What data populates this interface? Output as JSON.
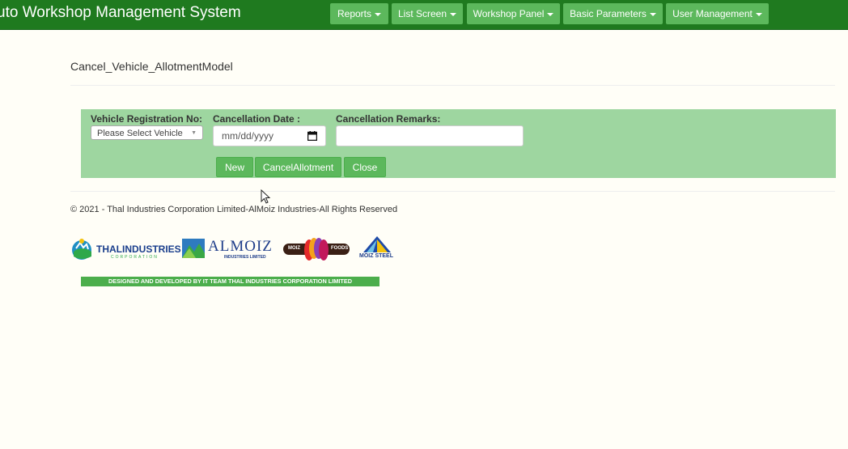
{
  "app": {
    "title": "uto Workshop Management System"
  },
  "nav": {
    "items": [
      {
        "label": "Reports"
      },
      {
        "label": "List Screen"
      },
      {
        "label": "Workshop Panel"
      },
      {
        "label": "Basic Parameters"
      },
      {
        "label": "User Management"
      }
    ]
  },
  "page": {
    "title": "Cancel_Vehicle_AllotmentModel"
  },
  "form": {
    "vehicle_label": "Vehicle Registration No:",
    "vehicle_selected": "Please Select Vehicle",
    "date_label": "Cancellation Date :",
    "date_placeholder": "mm/dd/yyyy",
    "remarks_label": "Cancellation Remarks:",
    "remarks_value": "",
    "buttons": {
      "new": "New",
      "cancel_allotment": "CancelAllotment",
      "close": "Close"
    }
  },
  "footer": {
    "copyright": "© 2021 - Thal Industries Corporation Limited-AlMoiz Industries-All Rights Reserved",
    "logos": {
      "thal": {
        "name": "THALINDUSTRIES",
        "sub": "CORPORATION"
      },
      "almoiz": {
        "name": "ALMOIZ",
        "sub": "INDUSTRIES LIMITED"
      },
      "moiz_foods": {
        "left": "MOIZ",
        "right": "FOODS"
      },
      "moiz_steel": {
        "name": "MOIZ STEEL"
      }
    },
    "designed_by": "DESIGNED AND DEVELOPED BY IT TEAM THAL INDUSTRIES CORPORATION LIMITED"
  },
  "colors": {
    "navbar": "#1f7a1f",
    "button": "#5cb85c",
    "panel": "#9ed6a0",
    "background": "#fffef7"
  }
}
